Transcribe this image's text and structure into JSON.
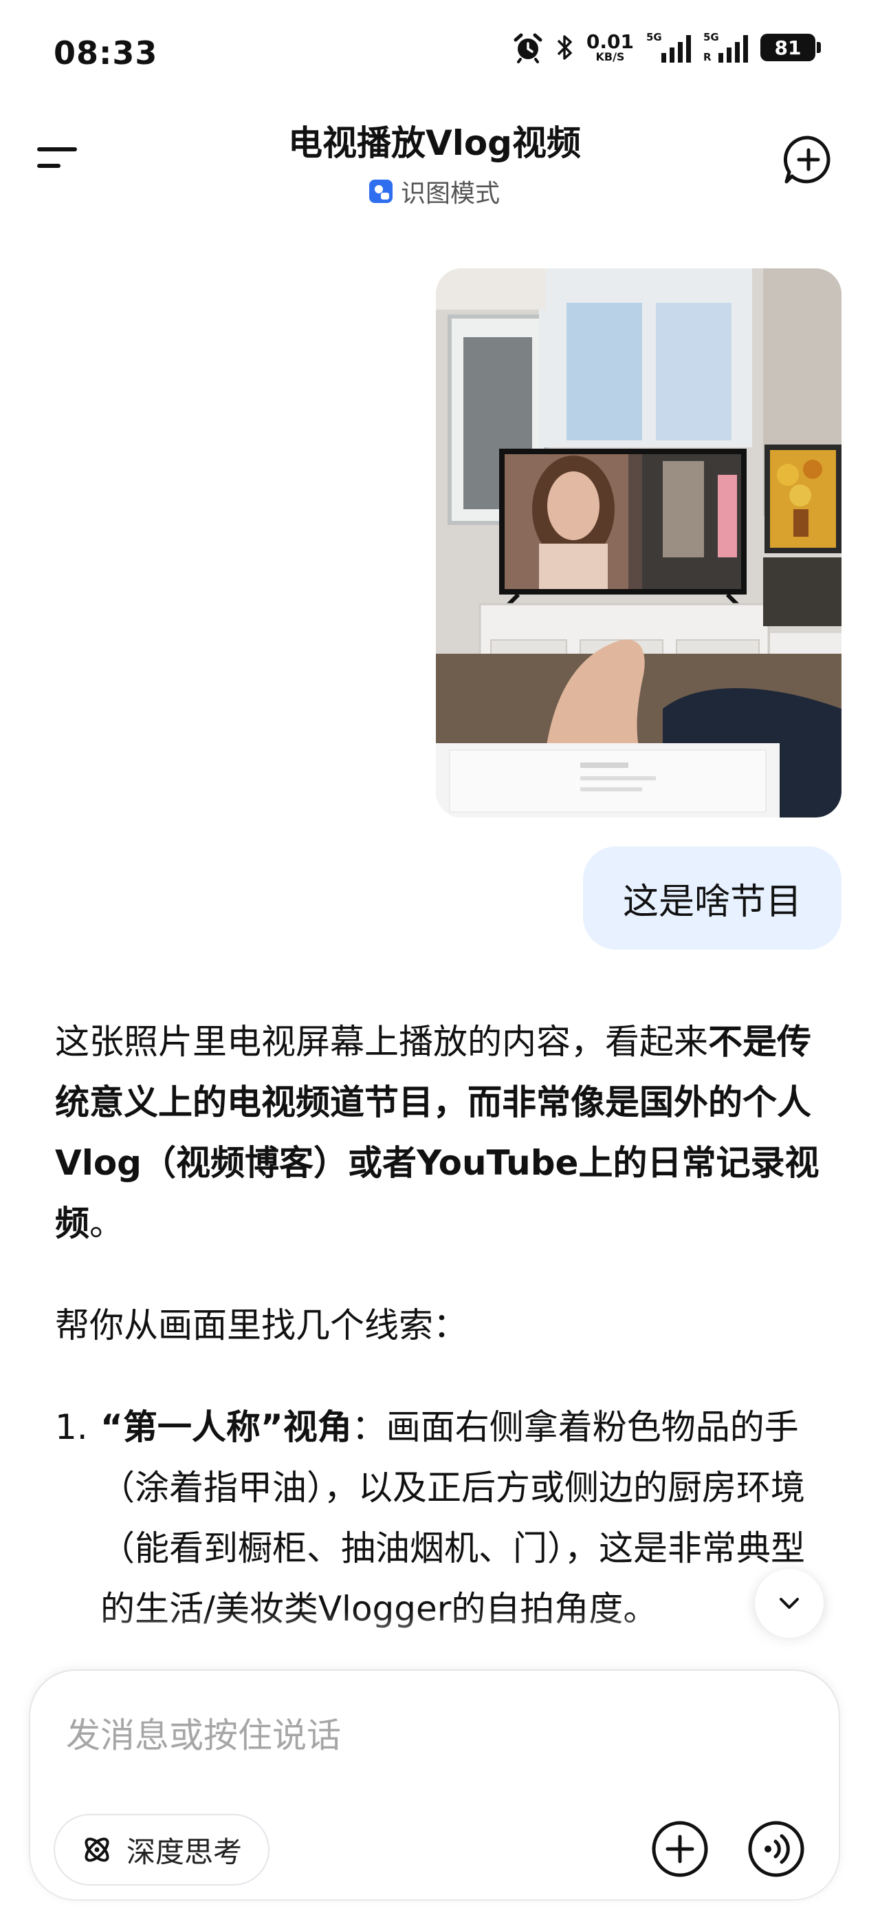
{
  "status_bar": {
    "time": "08:33",
    "net_speed_value": "0.01",
    "net_speed_unit": "KB/S",
    "sim1_label": "5G",
    "sim2_label": "5G",
    "sim2_roaming": "R",
    "battery": "81",
    "icons": [
      "alarm-icon",
      "bluetooth-icon",
      "signal-icon",
      "battery-icon"
    ]
  },
  "header": {
    "title": "电视播放Vlog视频",
    "mode_label": "识图模式",
    "icons": [
      "menu-icon",
      "mode-image-icon",
      "new-chat-icon"
    ]
  },
  "messages": {
    "user_text": "这是啥节目",
    "answer": {
      "p1_plain": "这张照片里电视屏幕上播放的内容，看起来",
      "p1_bold": "不是传统意义上的电视频道节目，而非常像是国外的个人Vlog（视频博客）或者YouTube上的日常记录视频",
      "p1_end": "。",
      "p2": "帮你从画面里找几个线索：",
      "item1_num": "1.",
      "item1_bold": "“第一人称”视角",
      "item1_text": "：画面右侧拿着粉色物品的手（涂着指甲油），以及正后方或侧边的厨房环境（能看到橱柜、抽油烟机、门），这是非常典型的生活/美妆类Vlogger的自拍角度。"
    }
  },
  "input": {
    "placeholder": "发消息或按住说话",
    "deep_think_label": "深度思考",
    "icons": [
      "deep-think-icon",
      "plus-icon",
      "voice-icon",
      "chevron-down-icon"
    ]
  },
  "colors": {
    "accent": "#2f6fef",
    "user_bubble": "#e8f1ff",
    "placeholder": "#a6a6a6"
  }
}
